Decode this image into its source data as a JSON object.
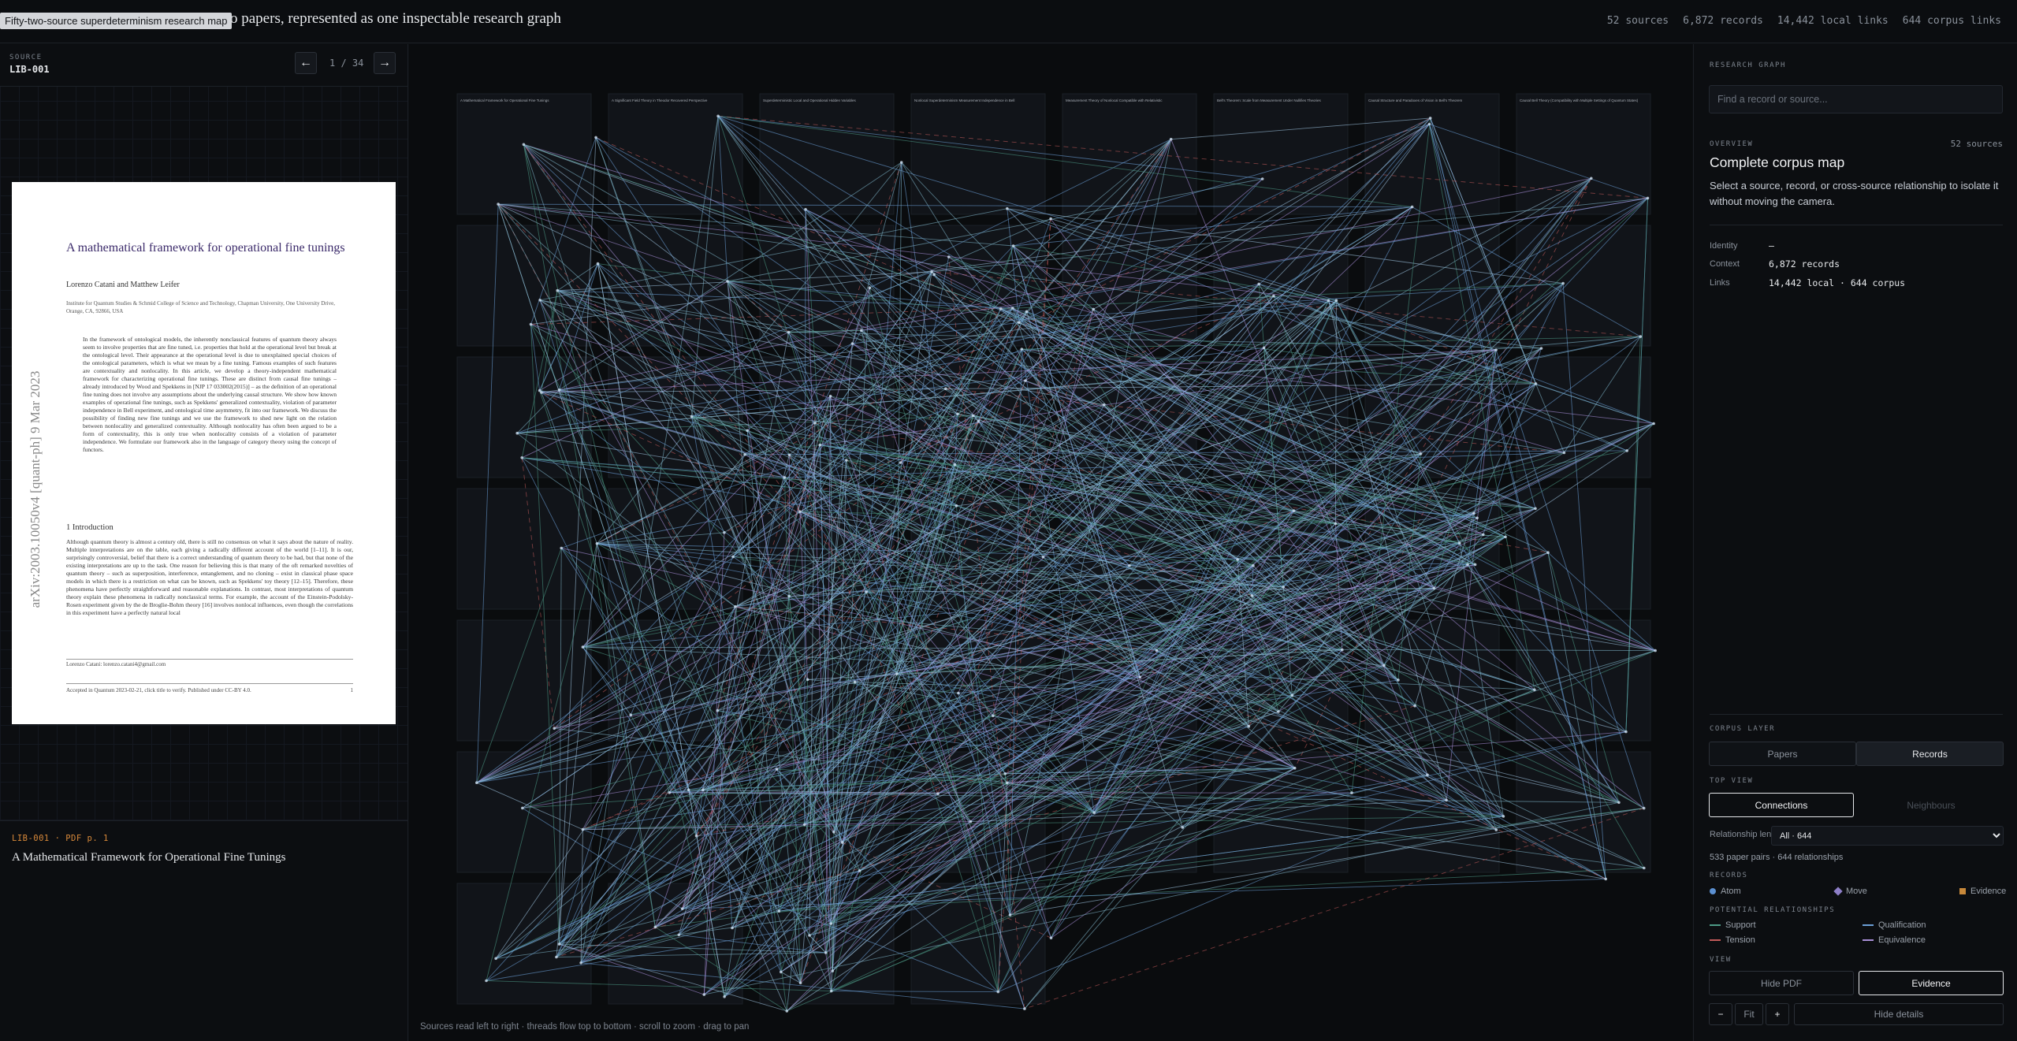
{
  "tooltip": "Fifty-two-source superdeterminism research map",
  "headline": "two papers, represented as one inspectable research graph",
  "stats": [
    "52 sources",
    "6,872 records",
    "14,442 local links",
    "644 corpus links"
  ],
  "source": {
    "label": "SOURCE",
    "id": "LIB-001",
    "pager": "1 / 34",
    "prev_icon": "←",
    "next_icon": "→",
    "meta": "LIB-001 · PDF p. 1",
    "title": "A Mathematical Framework for Operational Fine Tunings"
  },
  "pdf": {
    "title": "A mathematical framework for operational fine tunings",
    "authors": "Lorenzo Catani and Matthew Leifer",
    "affiliation": "Institute for Quantum Studies & Schmid College of Science and Technology, Chapman University, One University Drive, Orange, CA, 92866, USA",
    "abstract": "In the framework of ontological models, the inherently nonclassical features of quantum theory always seem to involve properties that are fine tuned, i.e. properties that hold at the operational level but break at the ontological level. Their appearance at the operational level is due to unexplained special choices of the ontological parameters, which is what we mean by a fine tuning. Famous examples of such features are contextuality and nonlocality. In this article, we develop a theory-independent mathematical framework for characterizing operational fine tunings. These are distinct from causal fine tunings – already introduced by Wood and Spekkens in [NJP 17 033002(2015)] – as the definition of an operational fine tuning does not involve any assumptions about the underlying causal structure. We show how known examples of operational fine tunings, such as Spekkens' generalized contextuality, violation of parameter independence in Bell experiment, and ontological time asymmetry, fit into our framework. We discuss the possibility of finding new fine tunings and we use the framework to shed new light on the relation between nonlocality and generalized contextuality. Although nonlocality has often been argued to be a form of contextuality, this is only true when nonlocality consists of a violation of parameter independence. We formulate our framework also in the language of category theory using the concept of functors.",
    "section": "1   Introduction",
    "body": "Although quantum theory is almost a century old, there is still no consensus on what it says about the nature of reality. Multiple interpretations are on the table, each giving a radically different account of the world [1–11]. It is our, surprisingly controversial, belief that there is a correct understanding of quantum theory to be had, but that none of the existing interpretations are up to the task. One reason for believing this is that many of the oft remarked novelties of quantum theory – such as superposition, interference, entanglement, and no cloning – exist in classical phase space models in which there is a restriction on what can be known, such as Spekkens' toy theory [12–15]. Therefore, these phenomena have perfectly straightforward and reasonable explanations. In contrast, most interpretations of quantum theory explain these phenomena in radically nonclassical terms. For example, the account of the Einstein-Podolsky-Rosen experiment given by the de Broglie-Bohm theory [16] involves nonlocal influences, even though the correlations in this experiment have a perfectly natural local",
    "footnote": "Lorenzo Catani: lorenzo.catani4@gmail.com",
    "footer": "Accepted in Quantum 2023-02-21, click title to verify. Published under CC-BY 4.0.",
    "page": "1",
    "arxiv": "arXiv:2003.10050v4  [quant-ph]  9 Mar 2023"
  },
  "graph": {
    "hint": "Sources read left to right · threads flow top to bottom · scroll to zoom · drag to pan",
    "card_titles": [
      "A Mathematical Framework for Operational Fine Tunings",
      "A Significant Field Theory in Theodor Recovered Perspective",
      "Superdeterministic Local and Operational Hidden Variables",
      "Nonlocal Superdeterminism Measurement Independence in Bell",
      "Measurement Theory of Nonlocal Compatible with Relativistic",
      "Bell's Theorem: Scale from Measurement Under Nullifies Theories",
      "Causal Structure and Paradoxes of Vision in Bell's Theorem",
      "Causal Bell Theory (Compatibility with Multiple Settings of Quantum States)"
    ]
  },
  "panel": {
    "section_label": "RESEARCH GRAPH",
    "search_placeholder": "Find a record or source...",
    "overview_label": "OVERVIEW",
    "overview_count": "52 sources",
    "overview_title": "Complete corpus map",
    "overview_desc": "Select a source, record, or cross-source relationship to isolate it without moving the camera.",
    "identity_label": "Identity",
    "identity_value": "–",
    "context_label": "Context",
    "context_value": "6,872 records",
    "links_label": "Links",
    "links_value": "14,442 local · 644 corpus",
    "corpus_layer_label": "CORPUS LAYER",
    "papers_label": "Papers",
    "records_label": "Records",
    "top_view_label": "TOP VIEW",
    "connections_label": "Connections",
    "neighbours_label": "Neighbours",
    "lens_label": "Relationship lens",
    "lens_value": "All · 644",
    "pairs_text": "533 paper pairs · 644 relationships",
    "records_legend_label": "RECORDS",
    "atom": "Atom",
    "move": "Move",
    "evidence": "Evidence",
    "potential_label": "POTENTIAL RELATIONSHIPS",
    "support": "Support",
    "qualification": "Qualification",
    "tension": "Tension",
    "equivalence": "Equivalence",
    "view_label": "VIEW",
    "hide_pdf": "Hide PDF",
    "evidence_btn": "Evidence",
    "minus": "−",
    "fit": "Fit",
    "plus": "+",
    "hide_details": "Hide details"
  },
  "colors": {
    "support": "#4d9a86",
    "qualification": "#6b9fd6",
    "tension": "#c25a5a",
    "equivalence": "#a98fd8",
    "atom": "#5b8fd0",
    "move": "#8e7fc8",
    "evidence": "#c7883a"
  }
}
